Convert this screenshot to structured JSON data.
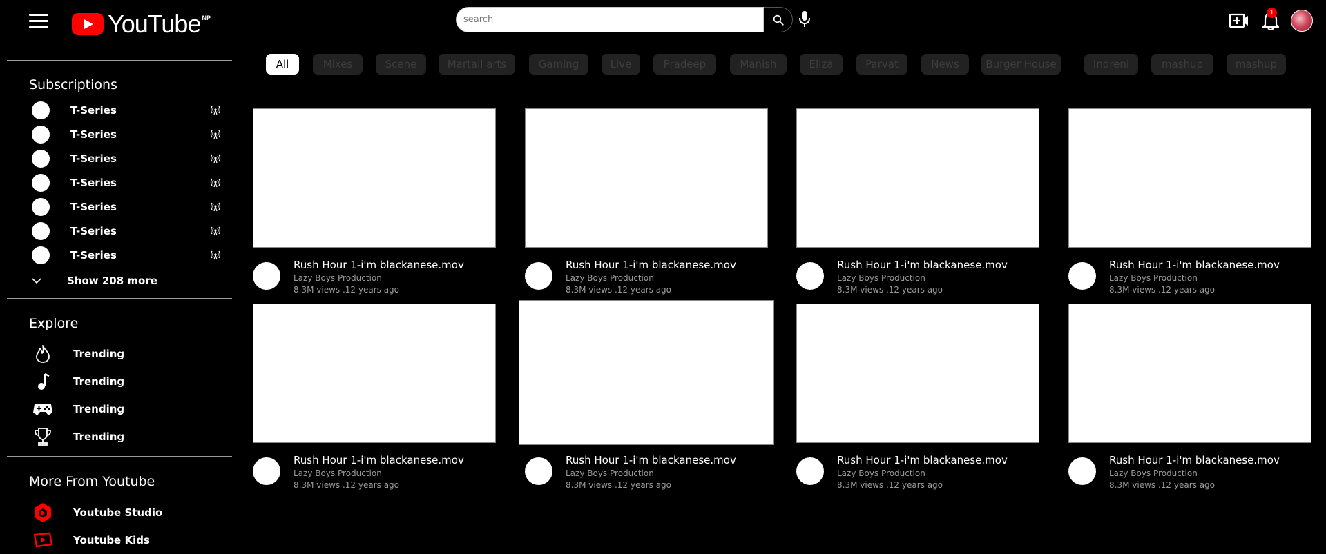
{
  "header": {
    "logo_text": "YouTube",
    "country_code": "NP",
    "search_placeholder": "search",
    "notification_count": "1",
    "brand_color": "#ff0000"
  },
  "sidebar": {
    "subscriptions_title": "Subscriptions",
    "subscriptions": [
      {
        "name": "T-Series",
        "icon": "live-icon"
      },
      {
        "name": "T-Series",
        "icon": "live-icon"
      },
      {
        "name": "T-Series",
        "icon": "live-icon"
      },
      {
        "name": "T-Series",
        "icon": "live-icon"
      },
      {
        "name": "T-Series",
        "icon": "live-icon"
      },
      {
        "name": "T-Series",
        "icon": "live-icon"
      },
      {
        "name": "T-Series",
        "icon": "live-icon"
      }
    ],
    "show_more_label": "Show 208 more",
    "explore_title": "Explore",
    "explore": [
      {
        "label": "Trending",
        "icon": "flame-icon"
      },
      {
        "label": "Trending",
        "icon": "music-note-icon"
      },
      {
        "label": "Trending",
        "icon": "gamepad-icon"
      },
      {
        "label": "Trending",
        "icon": "trophy-icon"
      }
    ],
    "more_title": "More From Youtube",
    "more": [
      {
        "label": "Youtube Studio",
        "icon": "youtube-studio-icon"
      },
      {
        "label": "Youtube Kids",
        "icon": "youtube-kids-icon"
      }
    ]
  },
  "chips": [
    "All",
    "Mixes",
    "Scene",
    "Martail arts",
    "Gaming",
    "Live",
    "Pradeep",
    "Manish",
    "Eliza",
    "Parvat",
    "News",
    "Burger House",
    "Indreni",
    "mashup",
    "mashup"
  ],
  "active_chip": "All",
  "videos": [
    {
      "title": "Rush Hour 1-i'm blackanese.mov",
      "channel": "Lazy Boys Production",
      "meta": "8.3M views .12 years ago"
    },
    {
      "title": "Rush Hour 1-i'm blackanese.mov",
      "channel": "Lazy Boys Production",
      "meta": "8.3M views .12 years ago"
    },
    {
      "title": "Rush Hour 1-i'm blackanese.mov",
      "channel": "Lazy Boys Production",
      "meta": "8.3M views .12 years ago"
    },
    {
      "title": "Rush Hour 1-i'm blackanese.mov",
      "channel": "Lazy Boys Production",
      "meta": "8.3M views .12 years ago"
    },
    {
      "title": "Rush Hour 1-i'm blackanese.mov",
      "channel": "Lazy Boys Production",
      "meta": "8.3M views .12 years ago"
    },
    {
      "title": "Rush Hour 1-i'm blackanese.mov",
      "channel": "Lazy Boys Production",
      "meta": "8.3M views .12 years ago"
    },
    {
      "title": "Rush Hour 1-i'm blackanese.mov",
      "channel": "Lazy Boys Production",
      "meta": "8.3M views .12 years ago"
    },
    {
      "title": "Rush Hour 1-i'm blackanese.mov",
      "channel": "Lazy Boys Production",
      "meta": "8.3M views .12 years ago"
    }
  ]
}
